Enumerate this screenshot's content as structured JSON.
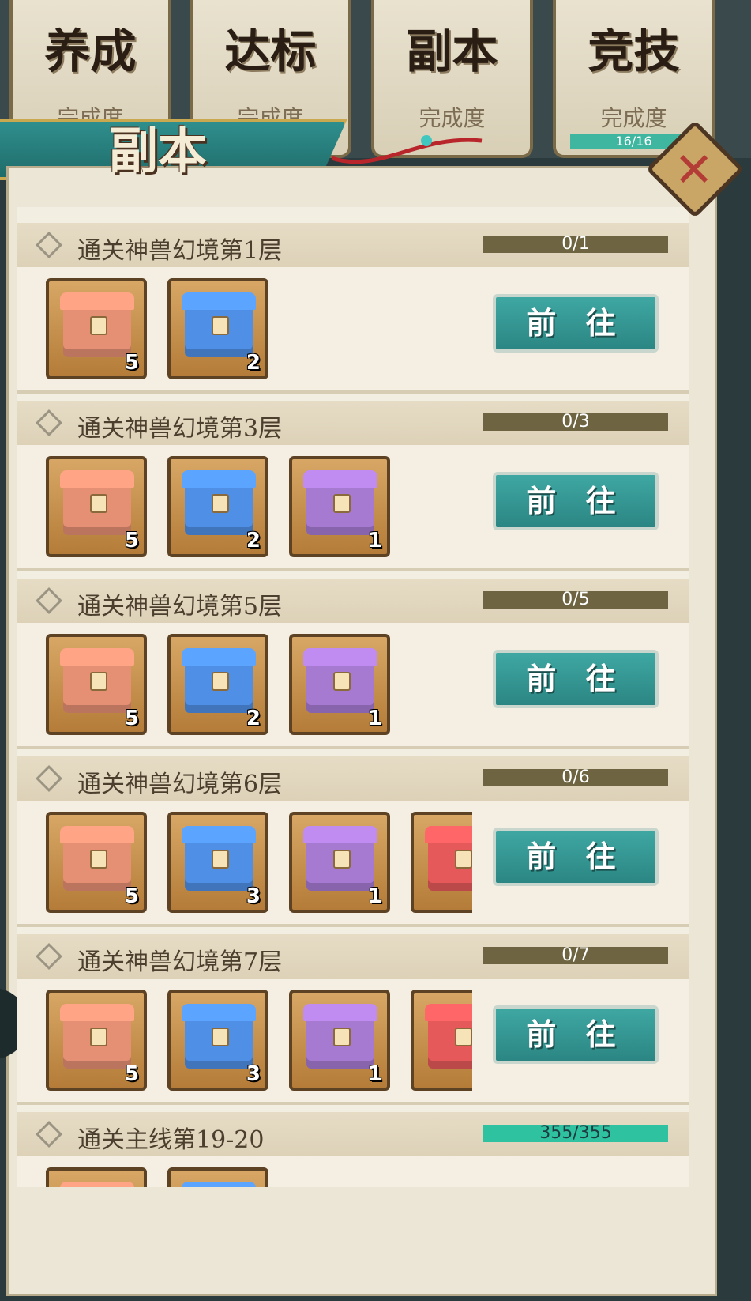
{
  "top_tabs": [
    {
      "name": "养成",
      "label": "完成度"
    },
    {
      "name": "达标",
      "label": "完成度"
    },
    {
      "name": "副本",
      "label": "完成度"
    },
    {
      "name": "竞技",
      "label": "完成度",
      "progress": "16/16"
    }
  ],
  "banner": {
    "title": "副本"
  },
  "colors": {
    "chest_orange": "#e58f74",
    "chest_blue": "#4f8fe6",
    "chest_purple": "#a77ad2",
    "chest_red": "#e6595a"
  },
  "go_label": "前 往",
  "tasks": [
    {
      "title": "通关神兽幻境第1层",
      "progress": "0/1",
      "rewards": [
        {
          "type": "chest_orange",
          "count": "5"
        },
        {
          "type": "chest_blue",
          "count": "2"
        }
      ]
    },
    {
      "title": "通关神兽幻境第3层",
      "progress": "0/3",
      "rewards": [
        {
          "type": "chest_orange",
          "count": "5"
        },
        {
          "type": "chest_blue",
          "count": "2"
        },
        {
          "type": "chest_purple",
          "count": "1"
        }
      ]
    },
    {
      "title": "通关神兽幻境第5层",
      "progress": "0/5",
      "rewards": [
        {
          "type": "chest_orange",
          "count": "5"
        },
        {
          "type": "chest_blue",
          "count": "2"
        },
        {
          "type": "chest_purple",
          "count": "1"
        }
      ]
    },
    {
      "title": "通关神兽幻境第6层",
      "progress": "0/6",
      "rewards": [
        {
          "type": "chest_orange",
          "count": "5"
        },
        {
          "type": "chest_blue",
          "count": "3"
        },
        {
          "type": "chest_purple",
          "count": "1"
        },
        {
          "type": "chest_red",
          "count": ""
        }
      ]
    },
    {
      "title": "通关神兽幻境第7层",
      "progress": "0/7",
      "rewards": [
        {
          "type": "chest_orange",
          "count": "5"
        },
        {
          "type": "chest_blue",
          "count": "3"
        },
        {
          "type": "chest_purple",
          "count": "1"
        },
        {
          "type": "chest_red",
          "count": ""
        }
      ]
    },
    {
      "title": "通关主线第19-20",
      "progress": "355/355",
      "completed": true,
      "rewards": [
        {
          "type": "chest_orange",
          "count": ""
        },
        {
          "type": "chest_blue",
          "count": ""
        }
      ]
    }
  ]
}
